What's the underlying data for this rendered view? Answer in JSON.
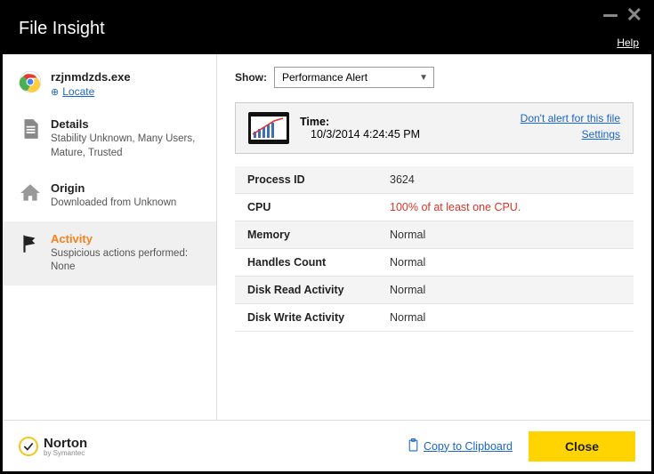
{
  "window": {
    "title": "File Insight",
    "help": "Help"
  },
  "file": {
    "name": "rzjnmdzds.exe",
    "locate_label": "Locate"
  },
  "nav": {
    "details": {
      "label": "Details",
      "sub": "Stability Unknown,  Many Users,  Mature,  Trusted"
    },
    "origin": {
      "label": "Origin",
      "sub": "Downloaded from Unknown"
    },
    "activity": {
      "label": "Activity",
      "sub": "Suspicious actions performed: None"
    }
  },
  "show": {
    "label": "Show:",
    "selected": "Performance Alert"
  },
  "meta": {
    "time_label": "Time:",
    "time_value": "10/3/2014 4:24:45 PM",
    "dont_alert": "Don't alert for this file",
    "settings": "Settings"
  },
  "rows": {
    "process_id": {
      "k": "Process ID",
      "v": "3624"
    },
    "cpu": {
      "k": "CPU",
      "v": "100% of at least one CPU."
    },
    "memory": {
      "k": "Memory",
      "v": "Normal"
    },
    "handles": {
      "k": "Handles Count",
      "v": "Normal"
    },
    "disk_read": {
      "k": "Disk Read Activity",
      "v": "Normal"
    },
    "disk_write": {
      "k": "Disk Write Activity",
      "v": "Normal"
    }
  },
  "footer": {
    "brand": "Norton",
    "by": "by Symantec",
    "copy": "Copy to Clipboard",
    "close": "Close"
  }
}
